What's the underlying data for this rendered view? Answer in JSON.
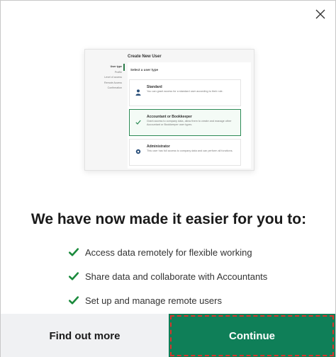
{
  "dialog": {
    "close_icon": "close-icon"
  },
  "preview": {
    "title": "Create New User",
    "steps": [
      "User type",
      "Profile",
      "Level of access",
      "Remote Access",
      "Confirmation"
    ],
    "subtitle": "Select a user type",
    "options": [
      {
        "title": "Standard",
        "description": "You can grant access for a standard user according to their role.",
        "icon": "user-icon",
        "selected": false
      },
      {
        "title": "Accountant or Bookkeeper",
        "description": "Grant access to company data, allow them to create and manage other Accountant or Bookkeeper user types.",
        "icon": "check-icon",
        "selected": true
      },
      {
        "title": "Administrator",
        "description": "This user has full access to company data and can perform all functions.",
        "icon": "gear-icon",
        "selected": false
      }
    ],
    "accent_color": "#2c8a55"
  },
  "heading": "We have now made it easier for you to:",
  "features": [
    "Access data remotely for flexible working",
    "Share data and collaborate with Accountants",
    "Set up and manage remote users"
  ],
  "check_color": "#1a8a3c",
  "buttons": {
    "find_out_more": "Find out more",
    "continue": "Continue",
    "primary_color": "#0f7f58"
  }
}
